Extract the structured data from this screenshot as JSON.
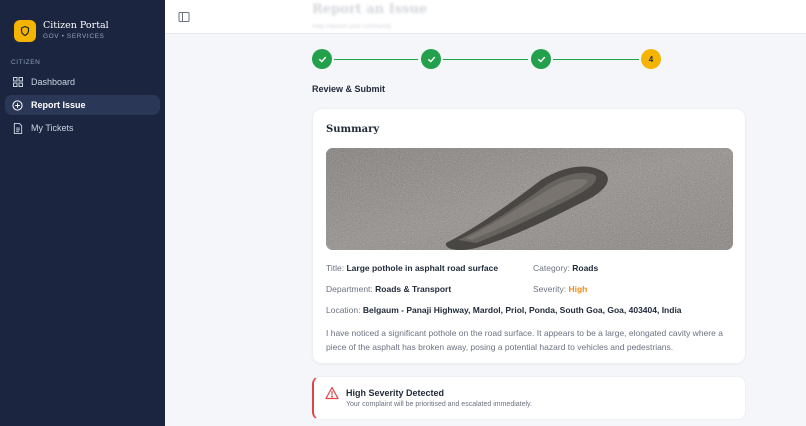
{
  "brand": {
    "title": "Citizen Portal",
    "subtitle": "GOV • SERVICES"
  },
  "sidebar": {
    "section_label": "CITIZEN",
    "items": [
      {
        "label": "Dashboard",
        "icon": "grid-icon",
        "active": false
      },
      {
        "label": "Report Issue",
        "icon": "plus-circle-icon",
        "active": true
      },
      {
        "label": "My Tickets",
        "icon": "document-icon",
        "active": false
      }
    ]
  },
  "header": {
    "title": "Report an Issue",
    "subtitle": "Help improve your community"
  },
  "stepper": {
    "steps": [
      "done",
      "done",
      "done",
      "current"
    ],
    "current_step": "4",
    "heading": "Review & Submit"
  },
  "summary": {
    "title": "Summary",
    "title_label": "Title:",
    "title_value": "Large pothole in asphalt road surface",
    "category_label": "Category:",
    "category_value": "Roads",
    "department_label": "Department:",
    "department_value": "Roads & Transport",
    "severity_label": "Severity:",
    "severity_value": "High",
    "location_label": "Location:",
    "location_value": "Belgaum - Panaji Highway, Mardol, Priol, Ponda, South Goa, Goa, 403404, India",
    "description": "I have noticed a significant pothole on the road surface. It appears to be a large, elongated cavity where a piece of the asphalt has broken away, posing a potential hazard to vehicles and pedestrians."
  },
  "alert": {
    "title": "High Severity Detected",
    "message": "Your complaint will be prioritised and escalated immediately."
  },
  "colors": {
    "sidebar_bg": "#1b2540",
    "accent_yellow": "#f5b400",
    "step_done_green": "#22a04b",
    "severity_orange": "#f28c18",
    "alert_red": "#e04444"
  }
}
